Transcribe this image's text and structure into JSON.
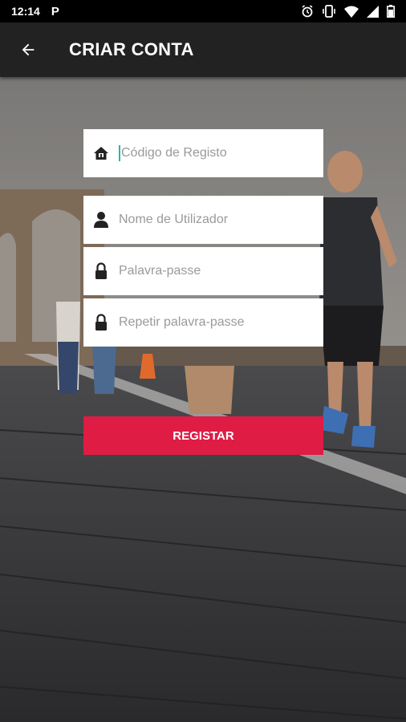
{
  "status_bar": {
    "time": "12:14",
    "app_icon": "P"
  },
  "app_bar": {
    "title": "CRIAR CONTA",
    "back_icon": "arrow-left-icon"
  },
  "form": {
    "registration_code": {
      "placeholder": "Código de Registo",
      "value": "",
      "icon": "house-icon"
    },
    "username": {
      "placeholder": "Nome de Utilizador",
      "value": "",
      "icon": "person-icon"
    },
    "password": {
      "placeholder": "Palavra-passe",
      "value": "",
      "icon": "lock-icon"
    },
    "repeat_password": {
      "placeholder": "Repetir palavra-passe",
      "value": "",
      "icon": "lock-icon"
    },
    "submit_label": "REGISTAR"
  },
  "colors": {
    "accent": "#df1c44",
    "app_bar": "#222222",
    "cursor": "#27b8a5"
  }
}
